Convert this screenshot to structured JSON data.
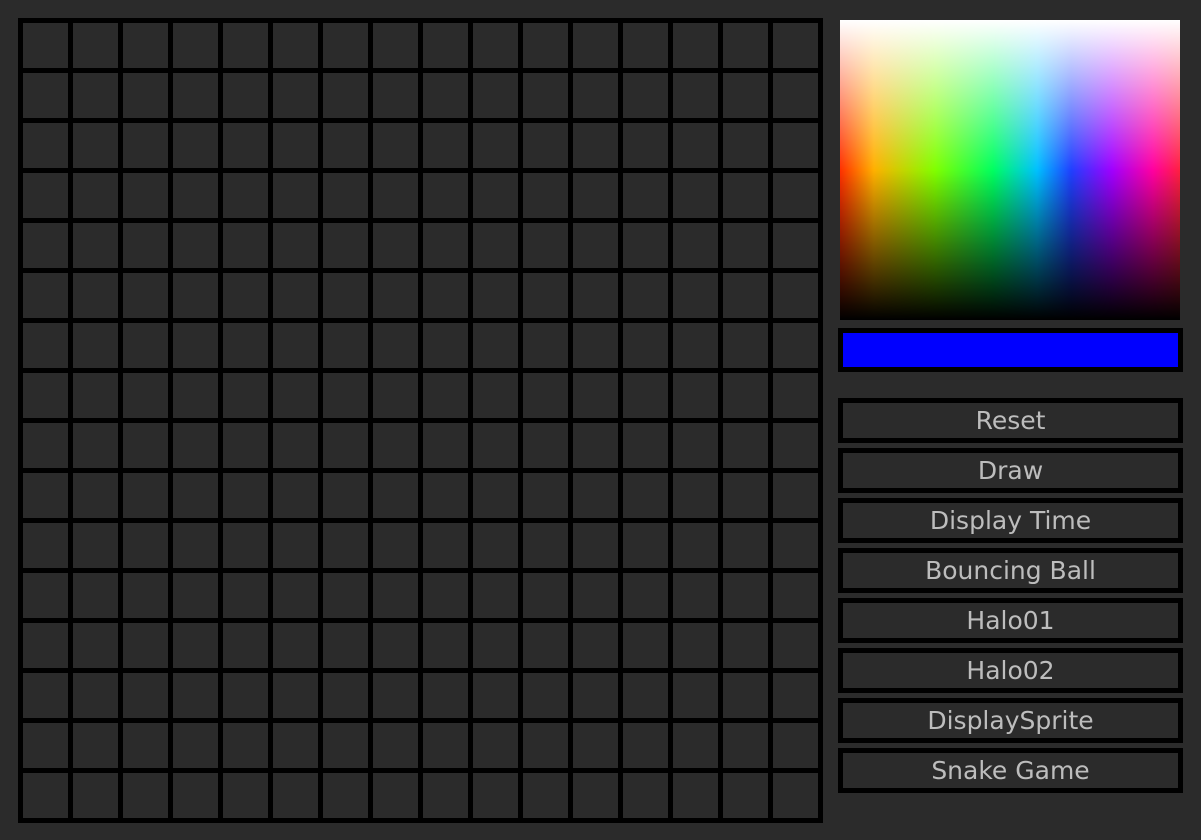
{
  "grid": {
    "rows": 16,
    "columns": 16,
    "cell_color": "#2b2b2b"
  },
  "color_picker": {
    "selected_color": "#0000ff"
  },
  "buttons": [
    {
      "label": "Reset"
    },
    {
      "label": "Draw"
    },
    {
      "label": "Display Time"
    },
    {
      "label": "Bouncing Ball"
    },
    {
      "label": "Halo01"
    },
    {
      "label": "Halo02"
    },
    {
      "label": "DisplaySprite"
    },
    {
      "label": "Snake Game"
    }
  ]
}
